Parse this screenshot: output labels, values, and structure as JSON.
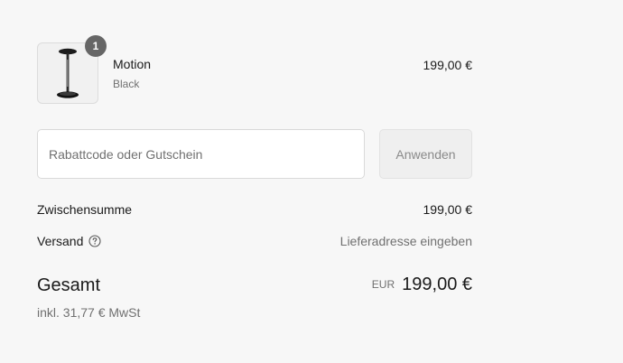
{
  "product": {
    "quantity": "1",
    "name": "Motion",
    "variant": "Black",
    "price": "199,00 €",
    "image_icon": "stool-product-image"
  },
  "discount": {
    "placeholder": "Rabattcode oder Gutschein",
    "apply_label": "Anwenden"
  },
  "summary": {
    "subtotal_label": "Zwischensumme",
    "subtotal_value": "199,00 €",
    "shipping_label": "Versand",
    "shipping_value": "Lieferadresse eingeben",
    "total_label": "Gesamt",
    "total_currency": "EUR",
    "total_value": "199,00 €",
    "tax_note": "inkl. 31,77 € MwSt"
  },
  "colors": {
    "background": "#f7f7f7",
    "badge": "#666666",
    "muted_text": "#707070"
  }
}
